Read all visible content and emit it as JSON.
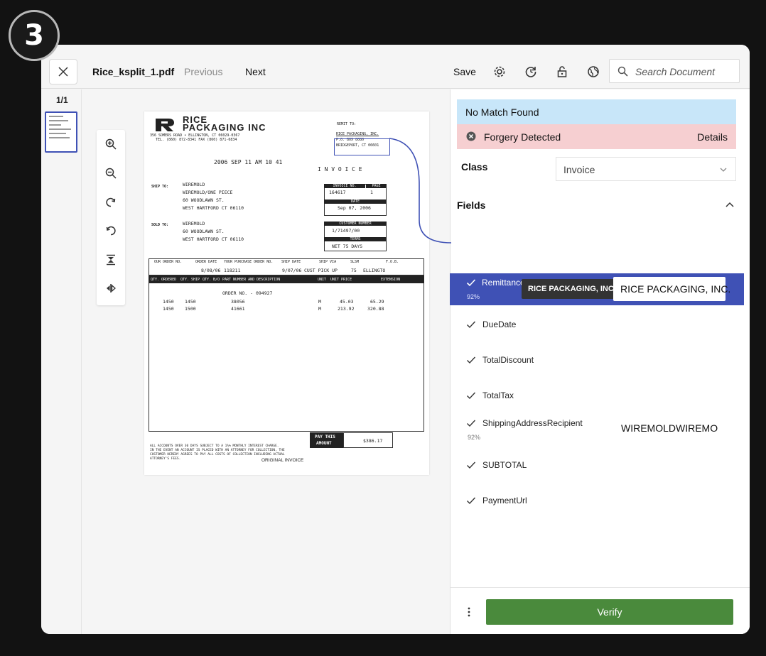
{
  "step_badge": "3",
  "toolbar": {
    "filename": "Rice_ksplit_1.pdf",
    "previous_label": "Previous",
    "next_label": "Next",
    "save_label": "Save",
    "search_placeholder": "Search Document",
    "icons": [
      "settings-icon",
      "reprocess-icon",
      "unlock-icon",
      "globe-icon",
      "search-icon"
    ]
  },
  "thumbnails": {
    "page_count": "1/1"
  },
  "viewer_tools": [
    "zoom-in-icon",
    "zoom-out-icon",
    "rotate-clockwise-icon",
    "rotate-counterclockwise-icon",
    "fit-height-icon",
    "fit-width-icon"
  ],
  "document": {
    "company_line1": "RICE",
    "company_line2": "PACKAGING INC",
    "address_line1": "356 SOMERS ROAD  •  ELLINGTON, CT  06029-0367",
    "address_line2": "TEL. (860) 872-8341                FAX (860) 871-6834",
    "remit_to": "REMIT TO:",
    "remit_line1": "RICE PACKAGING, INC.",
    "remit_line2": "P.O. BOX 8080",
    "remit_line3": "BRIDGEPORT, CT 06601",
    "stamp": "2006 SEP 11  AM 10 41",
    "invoice_title": "I N V O I C E",
    "ship_to_label": "SHIP TO:",
    "ship_to_lines": [
      "WIREMOLD",
      "WIREMOLD/ONE PIECE",
      "60 WOODLAWN ST.",
      "WEST HARTFORD  CT  06110"
    ],
    "sold_to_label": "SOLD TO:",
    "sold_to_lines": [
      "WIREMOLD",
      "60 WOODLAWN ST.",
      "WEST HARTFORD  CT  06110"
    ],
    "invoice_no_label": "INVOICE NO.",
    "invoice_no": "164617",
    "page_label": "PAGE",
    "page_no": "1",
    "date_label": "DATE",
    "date": "Sep 07, 2006",
    "customer_number_label": "CUSTOMER NUMBER",
    "customer_number": "1/71497/00",
    "terms_label": "TERMS",
    "terms": "NET 75 DAYS",
    "order_headers": [
      "OUR ORDER NO.",
      "ORDER DATE",
      "YOUR PURCHASE ORDER NO.",
      "SHIP DATE",
      "SHIP VIA",
      "SLSM",
      "F.O.B."
    ],
    "order_values": [
      "",
      "8/08/06",
      "118211",
      "9/07/06",
      "CUST PICK UP",
      "75",
      "ELLINGTO"
    ],
    "line_headers": [
      "QTY. ORDERED",
      "QTY. SHIP",
      "QTY. B/O",
      "PART NUMBER AND DESCRIPTION",
      "UNIT",
      "UNIT PRICE",
      "EXTENSION"
    ],
    "order_no_line": "ORDER NO. - 094927",
    "lines": [
      {
        "ordered": "1450",
        "ship": "1450",
        "part": "38056",
        "unit": "M",
        "price": "45.03",
        "ext": "65.29"
      },
      {
        "ordered": "1450",
        "ship": "1500",
        "part": "41661",
        "unit": "M",
        "price": "213.92",
        "ext": "320.88"
      }
    ],
    "pay_label_1": "PAY THIS",
    "pay_label_2": "AMOUNT",
    "pay_amount": "$386.17",
    "footer_lines": [
      "ALL ACCOUNTS OVER 30 DAYS SUBJECT TO A 1½% MONTHLY INTEREST CHARGE.",
      "IN THE EVENT AN ACCOUNT IS PLACED WITH AN ATTORNEY FOR COLLECTION, THE",
      "CUSTOMER HEREBY AGREES TO PAY ALL COSTS OF COLLECTION INCLUDING ACTUAL",
      "ATTORNEY'S FEES."
    ],
    "original_invoice": "ORIGINAL INVOICE"
  },
  "panel": {
    "no_match_text": "No Match Found",
    "forgery_text": "Forgery Detected",
    "details_label": "Details",
    "class_label": "Class",
    "class_value": "Invoice",
    "fields_label": "Fields",
    "fields": [
      {
        "name": "Remittance",
        "confidence": "92%",
        "tooltip": "RICE PACKAGING, INC.",
        "value": "RICE PACKAGING, INC."
      },
      {
        "name": "DueDate",
        "confidence": "",
        "value": ""
      },
      {
        "name": "TotalDiscount",
        "confidence": "",
        "value": ""
      },
      {
        "name": "TotalTax",
        "confidence": "",
        "value": ""
      },
      {
        "name": "ShippingAddressRecipient",
        "confidence": "92%",
        "value": "WIREMOLDWIREMOLD/("
      },
      {
        "name": "SUBTOTAL",
        "confidence": "",
        "value": ""
      },
      {
        "name": "PaymentUrl",
        "confidence": "",
        "value": ""
      }
    ],
    "verify_label": "Verify"
  },
  "colors": {
    "accent": "#3f51b5",
    "info_bg": "#c8e6f9",
    "danger_bg": "#f6cfd1",
    "verify": "#4a8a3c"
  }
}
